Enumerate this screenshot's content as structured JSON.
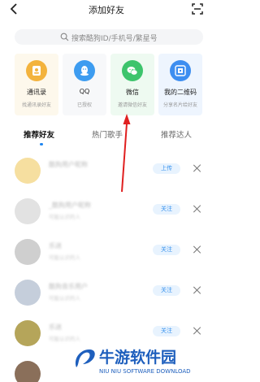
{
  "nav": {
    "title": "添加好友",
    "back_icon": "back-chevron-icon",
    "scan_icon": "scan-icon"
  },
  "search": {
    "placeholder": "搜索酷狗ID/手机号/繁星号",
    "icon": "search-icon"
  },
  "cards": [
    {
      "label": "通讯录",
      "sub": "找通讯录好友",
      "icon": "contacts-icon",
      "bg": "#fdf8ec",
      "color": "#f3b33d"
    },
    {
      "label": "QQ",
      "sub": "已授权",
      "icon": "qq-icon",
      "bg": "#f7f8fa",
      "color": "#3d9cf0"
    },
    {
      "label": "微信",
      "sub": "邀请微信好友",
      "icon": "wechat-icon",
      "bg": "#eefaf1",
      "color": "#3dc46c"
    },
    {
      "label": "我的二维码",
      "sub": "分享名片给好友",
      "icon": "qrcode-icon",
      "bg": "#eef5fe",
      "color": "#3d8ef0"
    }
  ],
  "tabs": [
    {
      "label": "推荐好友",
      "active": true
    },
    {
      "label": "热门歌手",
      "active": false
    },
    {
      "label": "推荐达人",
      "active": false
    }
  ],
  "rows": [
    {
      "name": "酷狗用户昵称",
      "desc": "",
      "button": "上传",
      "avatar_color": "#f3c64a"
    },
    {
      "name": "_酷狗用户昵称",
      "desc": "可能认识的人",
      "button": "关注",
      "avatar_color": "#d9d9d9"
    },
    {
      "name": "乐迷",
      "desc": "可能认识的人",
      "button": "关注",
      "avatar_color": "#bdbdbd"
    },
    {
      "name": "酷狗音乐用户",
      "desc": "可能认识的人",
      "button": "关注",
      "avatar_color": "#b8c3d2"
    },
    {
      "name": "乐迷",
      "desc": "可能认识的人",
      "button": "关注",
      "avatar_color": "#a5913c"
    },
    {
      "name": "",
      "desc": "",
      "button": "",
      "avatar_color": "#8a6f5a"
    }
  ],
  "watermark": {
    "cn": "牛游软件园",
    "en": "NIU NIU SOFTWARE DOWNLOAD",
    "color": "#1e5fbd"
  },
  "accent": "#1f86f0",
  "annotation_arrow_color": "#e02020"
}
